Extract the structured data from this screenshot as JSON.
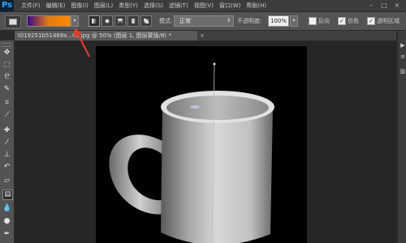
{
  "app": {
    "logo": "Ps"
  },
  "menu": [
    "文件(F)",
    "编辑(E)",
    "图像(I)",
    "图层(L)",
    "类型(Y)",
    "选择(S)",
    "滤镜(T)",
    "视图(V)",
    "窗口(W)",
    "帮助(H)"
  ],
  "options": {
    "gradient_colors": [
      "#3b0a83",
      "#e07c14",
      "#ff8a00"
    ],
    "mode_label": "模式:",
    "mode_value": "正常",
    "opacity_label": "不透明度:",
    "opacity_value": "100%",
    "reverse_label": "反向",
    "dither_label": "仿色",
    "dither_checked": "✓",
    "transparency_label": "透明区域",
    "transparency_checked": "✓"
  },
  "document": {
    "tab_title": "t019251b51468a...0c.jpg @ 50% (图层 1, 图层蒙版/8) *",
    "close_glyph": "×"
  },
  "toolbox_icons": [
    "move-icon",
    "marquee-icon",
    "lasso-icon",
    "quick-select-icon",
    "crop-icon",
    "eyedropper-icon",
    "healing-icon",
    "brush-icon",
    "clone-stamp-icon",
    "history-brush-icon",
    "eraser-icon",
    "gradient-icon",
    "blur-icon",
    "dodge-icon"
  ]
}
